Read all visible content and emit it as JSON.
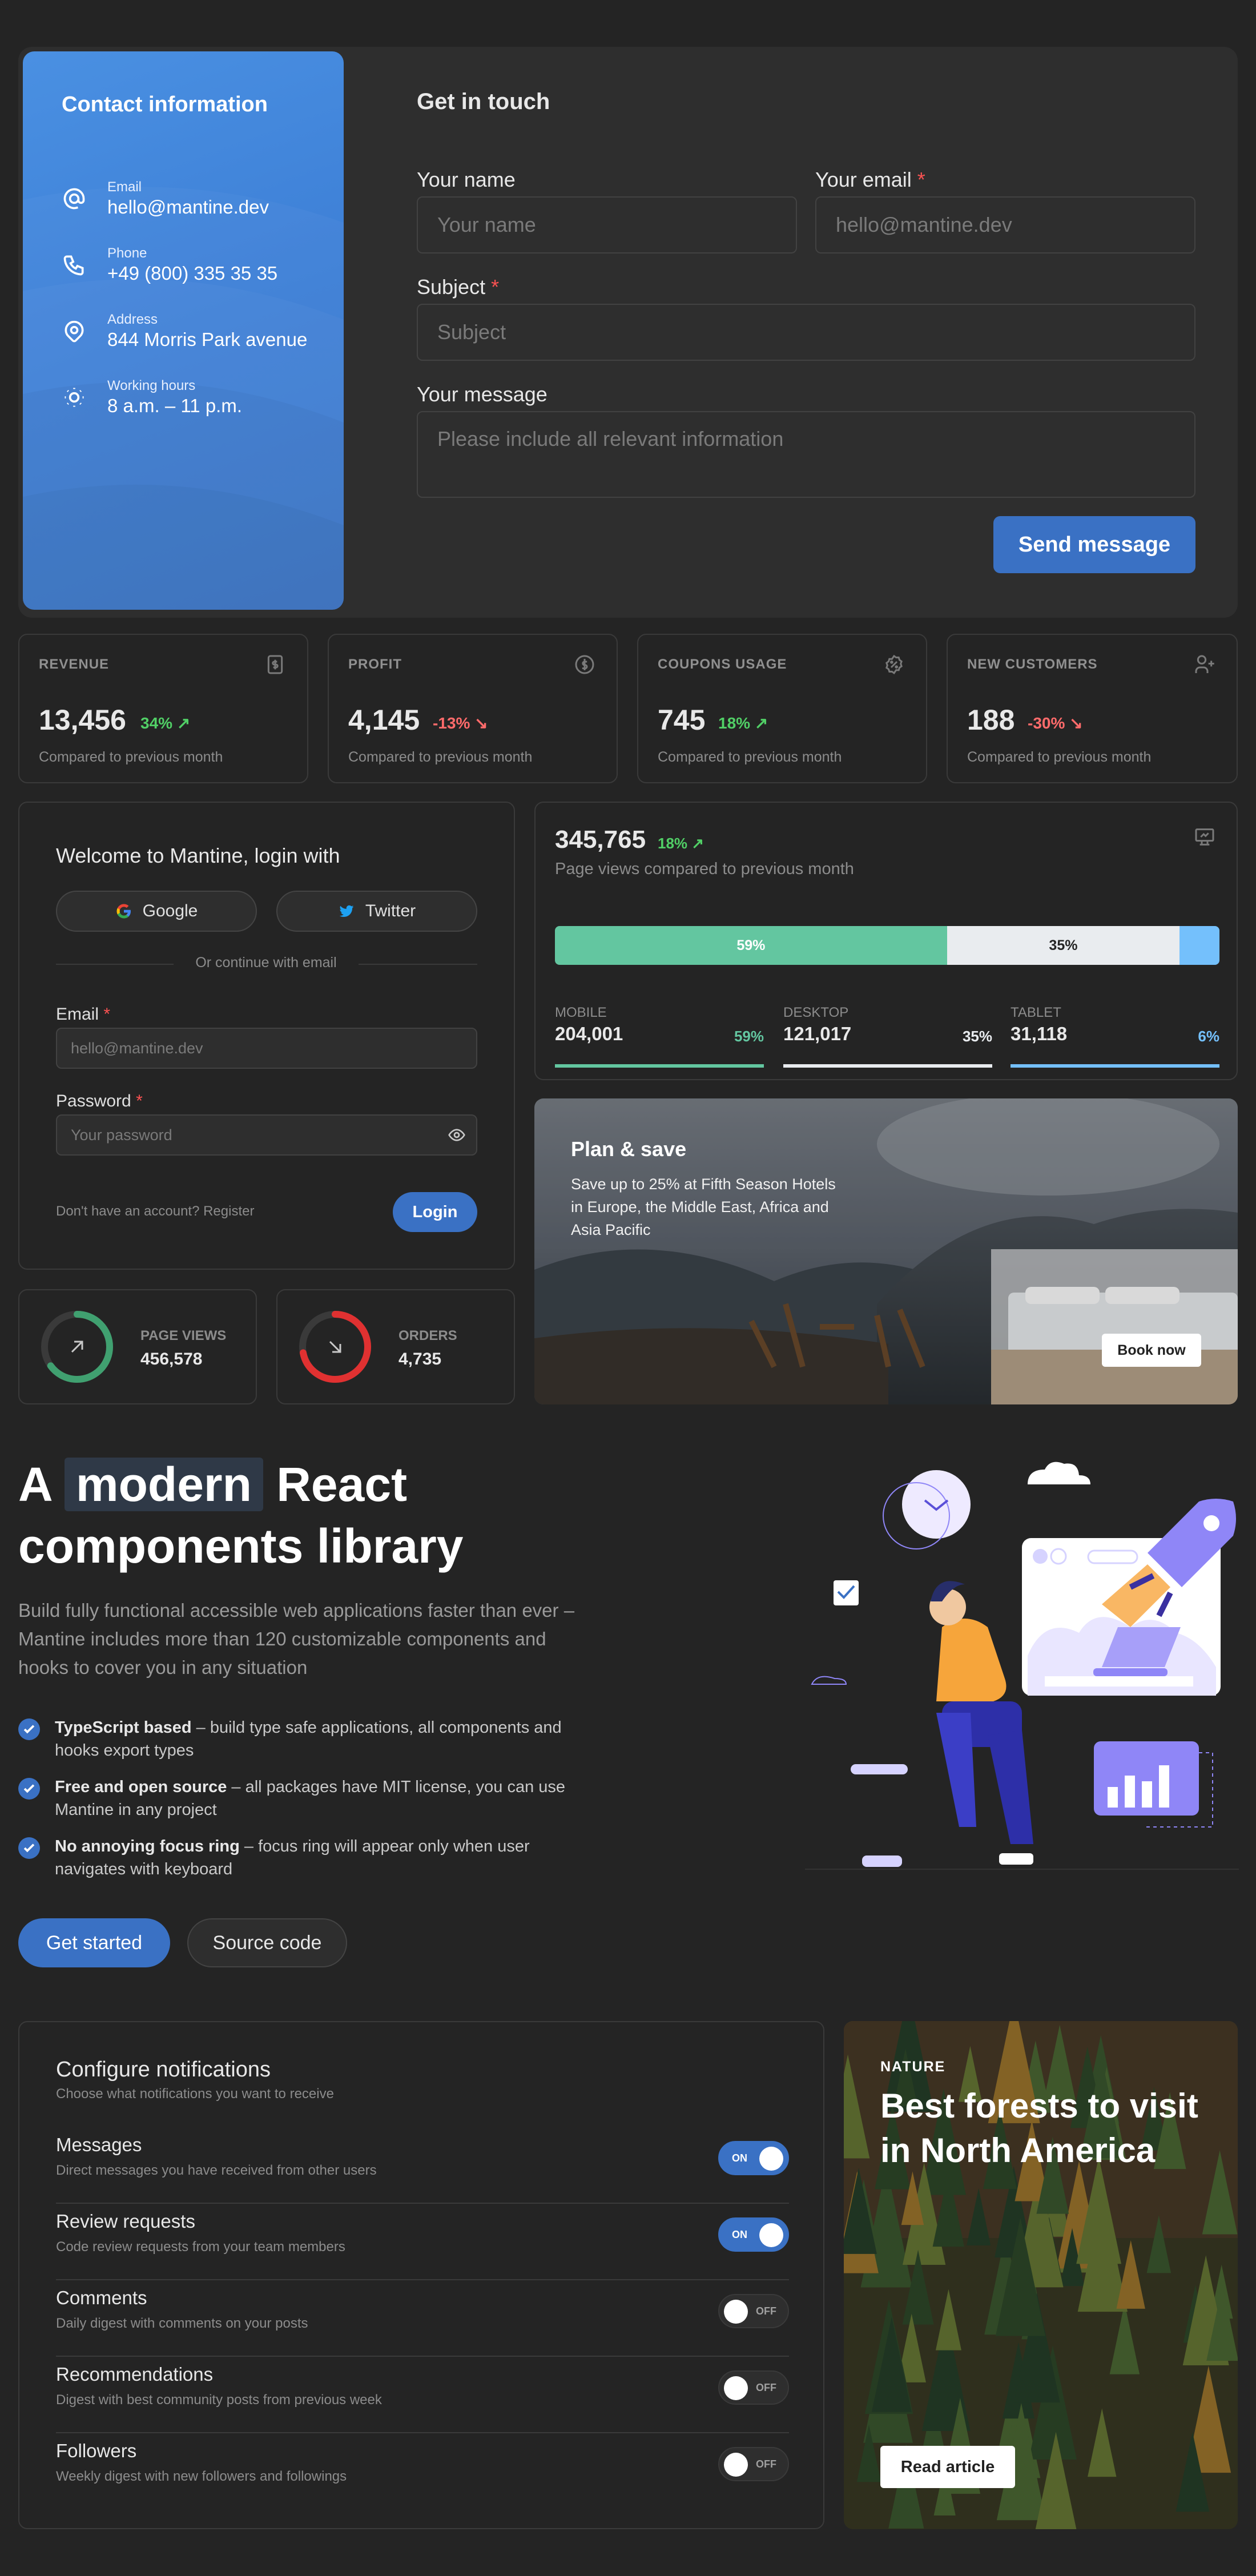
{
  "contact": {
    "panel_title": "Contact information",
    "items": [
      {
        "icon": "at-icon",
        "label": "Email",
        "value": "hello@mantine.dev"
      },
      {
        "icon": "phone-icon",
        "label": "Phone",
        "value": "+49 (800) 335 35 35"
      },
      {
        "icon": "map-pin-icon",
        "label": "Address",
        "value": "844 Morris Park avenue"
      },
      {
        "icon": "sun-icon",
        "label": "Working hours",
        "value": "8 a.m. – 11 p.m."
      }
    ],
    "form_title": "Get in touch",
    "name_label": "Your name",
    "name_placeholder": "Your name",
    "email_label": "Your email",
    "email_placeholder": "hello@mantine.dev",
    "subject_label": "Subject",
    "subject_placeholder": "Subject",
    "message_label": "Your message",
    "message_placeholder": "Please include all relevant information",
    "required_mark": "*",
    "send_button": "Send message"
  },
  "stats": [
    {
      "title": "REVENUE",
      "value": "13,456",
      "diff": "34%",
      "trend": "up",
      "icon": "receipt-icon",
      "compare": "Compared to previous month"
    },
    {
      "title": "PROFIT",
      "value": "4,145",
      "diff": "-13%",
      "trend": "down",
      "icon": "coin-icon",
      "compare": "Compared to previous month"
    },
    {
      "title": "COUPONS USAGE",
      "value": "745",
      "diff": "18%",
      "trend": "up",
      "icon": "discount-icon",
      "compare": "Compared to previous month"
    },
    {
      "title": "NEW CUSTOMERS",
      "value": "188",
      "diff": "-30%",
      "trend": "down",
      "icon": "user-plus-icon",
      "compare": "Compared to previous month"
    }
  ],
  "login": {
    "title": "Welcome to Mantine, login with",
    "google": "Google",
    "twitter": "Twitter",
    "divider": "Or continue with email",
    "email_label": "Email",
    "email_placeholder": "hello@mantine.dev",
    "password_label": "Password",
    "password_placeholder": "Your password",
    "register": "Don't have an account? Register",
    "login_button": "Login"
  },
  "ring_stats": [
    {
      "label": "PAGE VIEWS",
      "value": "456,578",
      "progress": 0.65,
      "color": "#40a070",
      "icon": "arrow-up-right-icon"
    },
    {
      "label": "ORDERS",
      "value": "4,735",
      "progress": 0.72,
      "color": "#e03131",
      "icon": "arrow-down-right-icon"
    }
  ],
  "pageviews": {
    "total": "345,765",
    "diff": "18%",
    "caption": "Page views compared to previous month",
    "segments": [
      {
        "label": "MOBILE",
        "count": "204,001",
        "part": "59%",
        "fraction": 0.59,
        "color": "#63c6a0"
      },
      {
        "label": "DESKTOP",
        "count": "121,017",
        "part": "35%",
        "fraction": 0.35,
        "color": "#e9ecef"
      },
      {
        "label": "TABLET",
        "count": "31,118",
        "part": "6%",
        "fraction": 0.06,
        "color": "#74c0fc"
      }
    ]
  },
  "promo": {
    "title": "Plan & save",
    "text": "Save up to 25% at Fifth Season Hotels in Europe, the Middle East, Africa and Asia Pacific",
    "button": "Book now"
  },
  "hero": {
    "title_a": "A",
    "title_highlight": "modern",
    "title_b": "React",
    "title_line2": "components library",
    "description": "Build fully functional accessible web applications faster than ever – Mantine includes more than 120 customizable components and hooks to cover you in any situation",
    "features": [
      {
        "bold": "TypeScript based",
        "text": " – build type safe applications, all components and hooks export types"
      },
      {
        "bold": "Free and open source",
        "text": " – all packages have MIT license, you can use Mantine in any project"
      },
      {
        "bold": "No annoying focus ring",
        "text": " – focus ring will appear only when user navigates with keyboard"
      }
    ],
    "primary_button": "Get started",
    "secondary_button": "Source code"
  },
  "notifications": {
    "title": "Configure notifications",
    "subtitle": "Choose what notifications you want to receive",
    "on_label": "ON",
    "off_label": "OFF",
    "items": [
      {
        "title": "Messages",
        "desc": "Direct messages you have received from other users",
        "on": true
      },
      {
        "title": "Review requests",
        "desc": "Code review requests from your team members",
        "on": true
      },
      {
        "title": "Comments",
        "desc": "Daily digest with comments on your posts",
        "on": false
      },
      {
        "title": "Recommendations",
        "desc": "Digest with best community posts from previous week",
        "on": false
      },
      {
        "title": "Followers",
        "desc": "Weekly digest with new followers and followings",
        "on": false
      }
    ]
  },
  "article": {
    "category": "NATURE",
    "title": "Best forests to visit in North America",
    "button": "Read article"
  }
}
